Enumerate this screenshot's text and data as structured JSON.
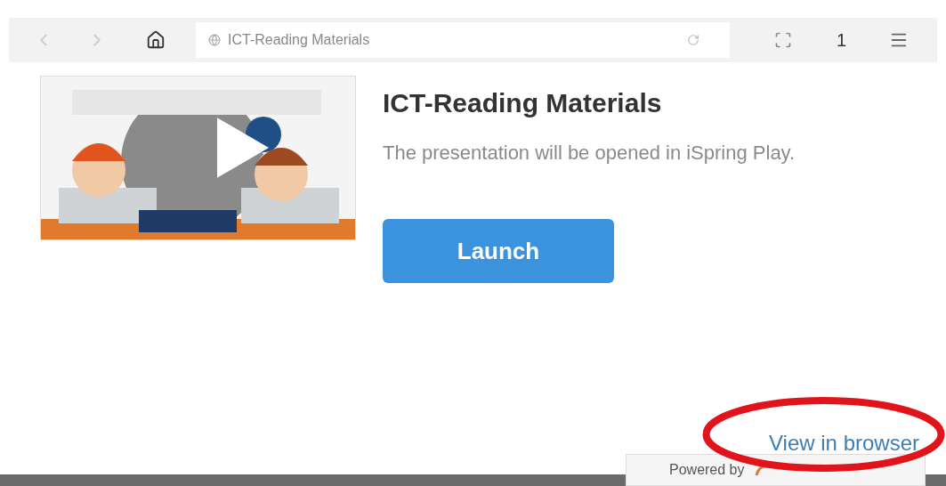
{
  "browser": {
    "address": "ICT-Reading Materials",
    "tab_count": "1"
  },
  "content": {
    "title": "ICT-Reading Materials",
    "description": "The presentation will be opened in iSpring Play.",
    "launch_button": "Launch",
    "view_link": "View in browser",
    "powered_by": "Powered by"
  },
  "annotations": [
    {
      "kind": "ellipse"
    }
  ]
}
